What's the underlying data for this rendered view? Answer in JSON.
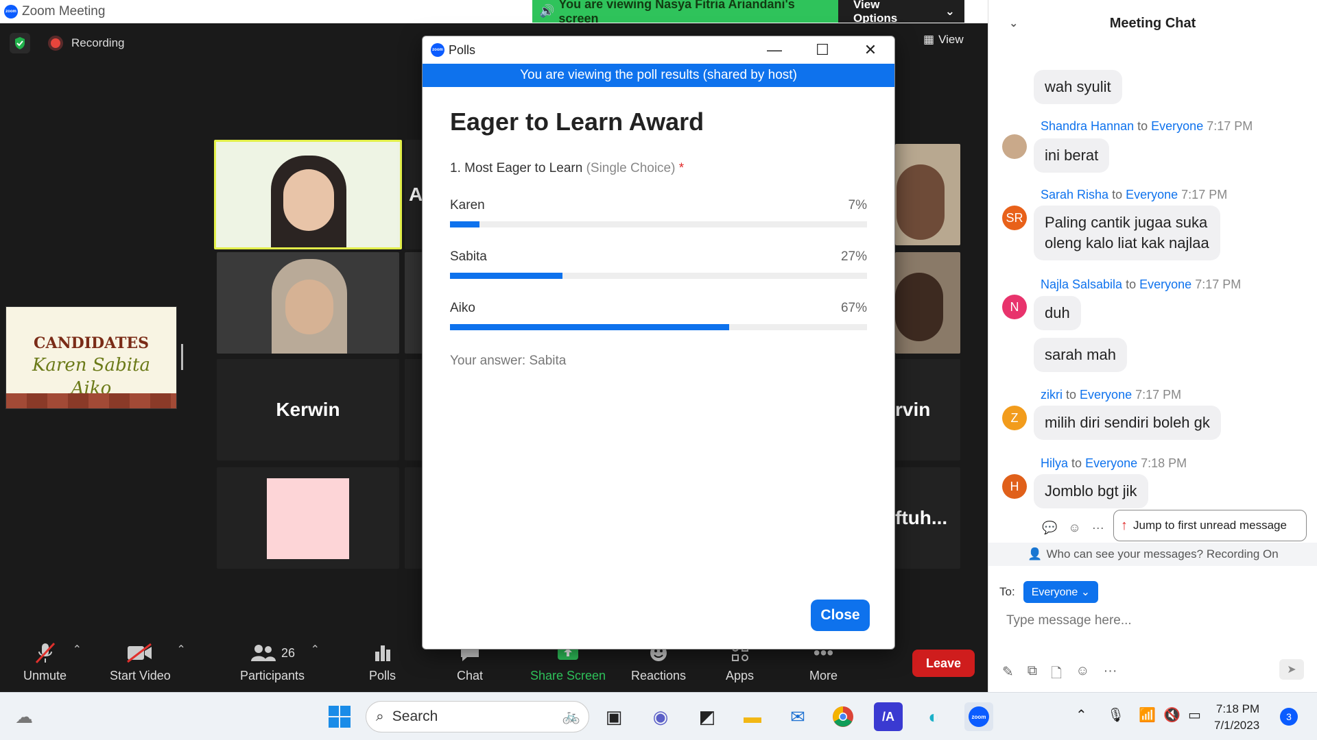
{
  "window": {
    "title": "Zoom Meeting",
    "min": "—",
    "max": "❐",
    "close": "✕"
  },
  "banner": {
    "share_text": "You are viewing Nasya Fitria Ariandani's screen",
    "options_label": "View Options"
  },
  "meeting": {
    "recording_label": "Recording",
    "view_label": "View"
  },
  "thumbnail": {
    "title": "CANDIDATES",
    "names": "Karen  Sabita",
    "names2": "Aiko"
  },
  "tiles": [
    {
      "name": "Kerwin"
    },
    {
      "name": "rvin"
    },
    {
      "name": "ftuh..."
    },
    {
      "name": "A"
    }
  ],
  "poll": {
    "window_title": "Polls",
    "banner": "You are viewing the poll results (shared by host)",
    "title": "Eager to Learn Award",
    "question": "1. Most Eager to Learn",
    "question_type": "(Single Choice)",
    "required_mark": "*",
    "options": [
      {
        "label": "Karen",
        "percent_label": "7%",
        "percent": 7
      },
      {
        "label": "Sabita",
        "percent_label": "27%",
        "percent": 27
      },
      {
        "label": "Aiko",
        "percent_label": "67%",
        "percent": 67
      }
    ],
    "answer": "Your answer: Sabita",
    "close_label": "Close"
  },
  "toolbar": {
    "unmute": "Unmute",
    "start_video": "Start Video",
    "participants": "Participants",
    "participants_count": "26",
    "polls": "Polls",
    "chat": "Chat",
    "share_screen": "Share Screen",
    "reactions": "Reactions",
    "apps": "Apps",
    "more": "More",
    "leave": "Leave"
  },
  "chat": {
    "title": "Meeting Chat",
    "to_word": "to",
    "messages": [
      {
        "text": "wah syulit"
      },
      {
        "sender": "Shandra Hannan",
        "recipient": "Everyone",
        "time": "7:17 PM",
        "text": "ini berat"
      },
      {
        "sender": "Sarah Risha",
        "initials": "SR",
        "recipient": "Everyone",
        "time": "7:17 PM",
        "text1": "Paling cantik jugaa suka",
        "text2": "oleng kalo liat kak najlaa"
      },
      {
        "sender": "Najla Salsabila",
        "initials": "N",
        "recipient": "Everyone",
        "time": "7:17 PM",
        "text": "duh",
        "text_b": "sarah mah"
      },
      {
        "sender": "zikri",
        "initials": "Z",
        "recipient": "Everyone",
        "time": "7:17 PM",
        "text": "milih diri sendiri boleh gk"
      },
      {
        "sender": "Hilya",
        "initials": "H",
        "recipient": "Everyone",
        "time": "7:18 PM",
        "text": "Jomblo bgt jik"
      }
    ],
    "jump_label": "Jump to first unread message",
    "visibility_note": "Who can see your messages? Recording On",
    "to_label": "To:",
    "to_value": "Everyone",
    "input_placeholder": "Type message here..."
  },
  "taskbar": {
    "search_label": "Search",
    "time": "7:18 PM",
    "date": "7/1/2023",
    "notification_count": "3"
  }
}
